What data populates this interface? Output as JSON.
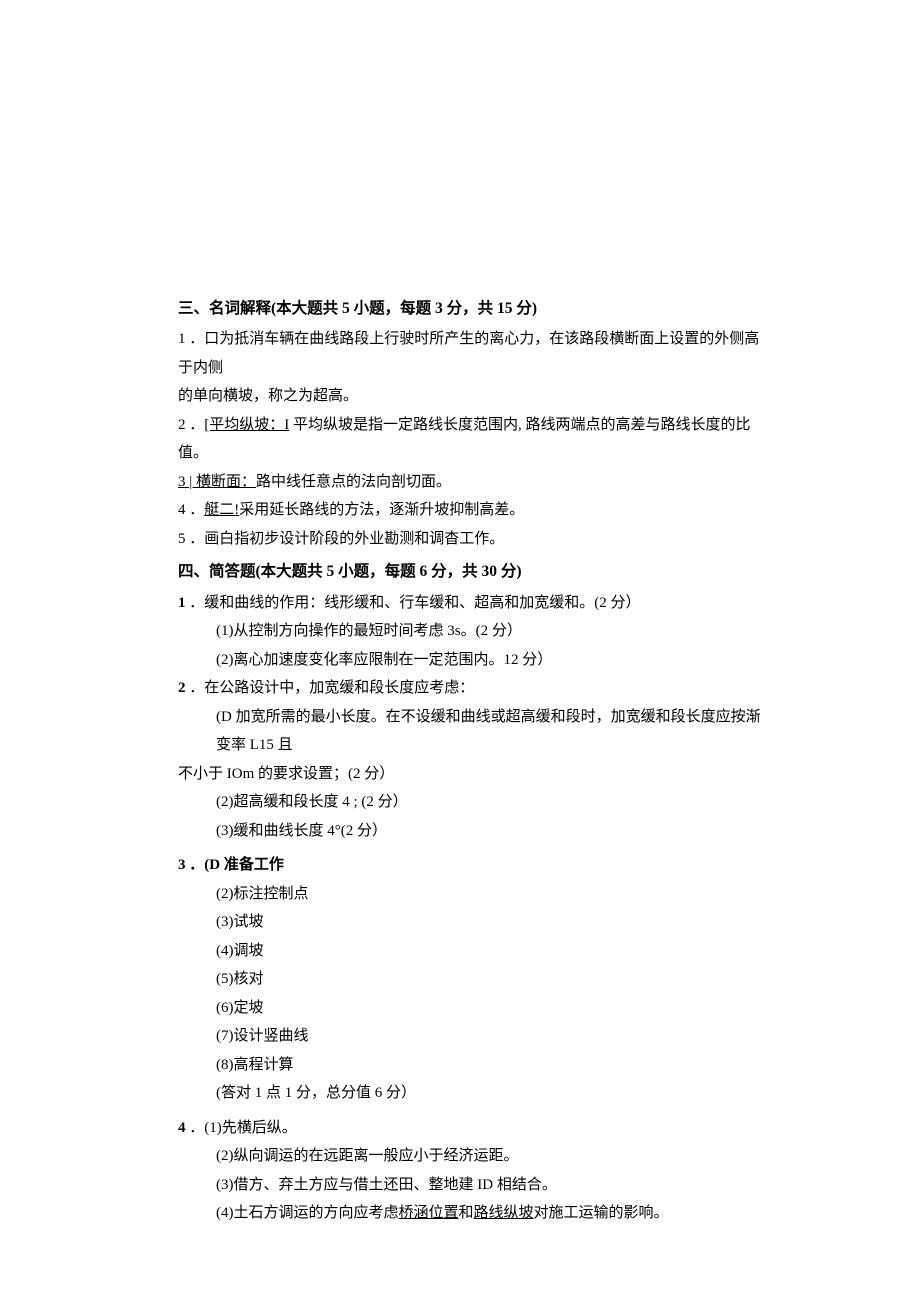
{
  "section3": {
    "heading": "三、名词解释(本大题共 5 小题，每题 3 分，共 15 分)",
    "items": [
      {
        "num": "1",
        "text_a": "．",
        "text_b": "口为抵消车辆在曲线路段上行驶时所产生的离心力，在该路段横断面上设置的外侧高于内侧"
      },
      {
        "cont": "的单向横坡，称之为超高。"
      },
      {
        "num": "2",
        "text_a": "．",
        "u": "[平均纵坡：I",
        "text_b": " 平均纵坡是指一定路线长度范围内, 路线两端点的高差与路线长度的比值。"
      },
      {
        "num_u": "3 | 横断面：",
        "text_b": "路中线任意点的法向剖切面。"
      },
      {
        "num": "4",
        "text_a": "．",
        "u": "艇二!",
        "text_b": "采用延长路线的方法，逐渐升坡抑制高差。"
      },
      {
        "num": "5",
        "text_a": "．画白指初步设计阶段的外业勘测和调杳工作。"
      }
    ]
  },
  "section4": {
    "heading": "四、简答题(本大题共 5 小题，每题 6 分，共 30 分)",
    "q1": {
      "num": "1",
      "lead": "．缓和曲线的作用：线形缓和、行车缓和、超高和加宽缓和。(2 分）",
      "subs": [
        "(1)从控制方向操作的最短时间考虑 3s。(2 分）",
        "(2)离心加速度变化率应限制在一定范围内。12 分）"
      ]
    },
    "q2": {
      "num": "2",
      "lead": "．在公路设计中，加宽缓和段长度应考虑：",
      "line1": "(D 加宽所需的最小长度。在不设缓和曲线或超高缓和段时，加宽缓和段长度应按渐变率 L15 且",
      "line2": "不小于 IOm 的要求设置；(2 分）",
      "subs": [
        "(2)超高缓和段长度 4 ; (2 分）",
        "(3)缓和曲线长度 4°(2 分）"
      ]
    },
    "q3": {
      "num": "3",
      "lead": "．(D 准备工作",
      "subs": [
        "(2)标注控制点",
        "(3)试坡",
        "(4)调坡",
        "(5)核对",
        "(6)定坡",
        "(7)设计竖曲线",
        "(8)高程计算",
        "(答对 1 点 1 分，总分值 6 分）"
      ]
    },
    "q4": {
      "num": "4",
      "lead": "．(1)先横后纵。",
      "subs": [
        "(2)纵向调运的在远距离一般应小于经济运距。",
        "(3)借方、弃土方应与借土还田、整地建 ID 相结合。"
      ],
      "final_a": "(4)土石方调运的方向应考虑",
      "final_u1": "桥涵位置",
      "final_mid": "和",
      "final_u2": "路线纵坡",
      "final_b": "对施工运输的影响。"
    }
  }
}
